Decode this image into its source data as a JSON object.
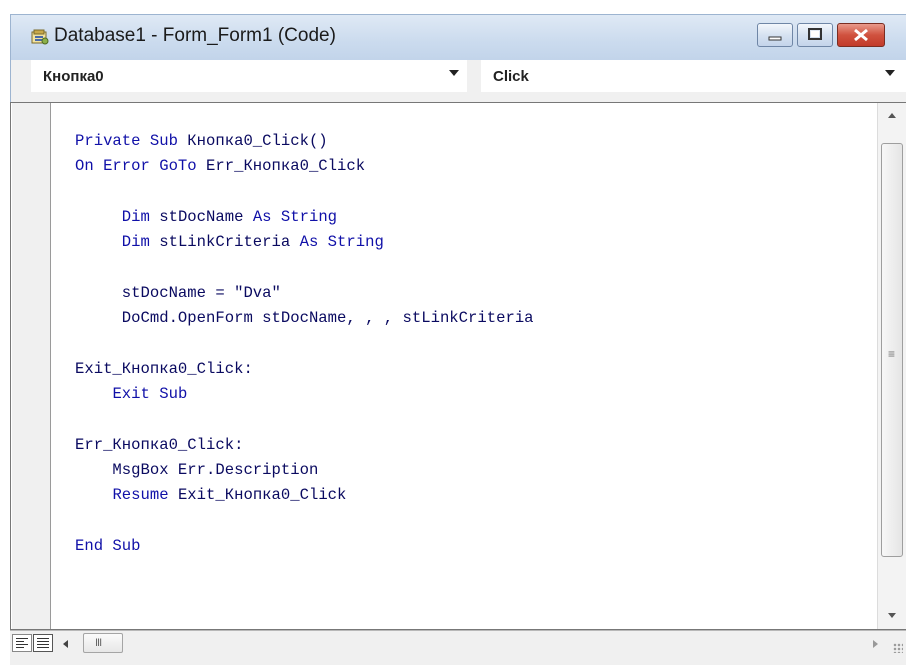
{
  "window": {
    "title": "Database1 - Form_Form1 (Code)"
  },
  "toolbar": {
    "object_combo": "Кнопка0",
    "procedure_combo": "Click"
  },
  "code_lines": [
    [
      {
        "t": "Private Sub ",
        "k": 1
      },
      {
        "t": "Кнопка0_Click()",
        "k": 0
      }
    ],
    [
      {
        "t": "On Error GoTo ",
        "k": 1
      },
      {
        "t": "Err_Кнопка0_Click",
        "k": 0
      }
    ],
    [],
    [
      {
        "t": "     ",
        "k": 0
      },
      {
        "t": "Dim ",
        "k": 1
      },
      {
        "t": "stDocName ",
        "k": 0
      },
      {
        "t": "As String",
        "k": 1
      }
    ],
    [
      {
        "t": "     ",
        "k": 0
      },
      {
        "t": "Dim ",
        "k": 1
      },
      {
        "t": "stLinkCriteria ",
        "k": 0
      },
      {
        "t": "As String",
        "k": 1
      }
    ],
    [],
    [
      {
        "t": "     stDocName = \"Dva\"",
        "k": 0
      }
    ],
    [
      {
        "t": "     DoCmd.OpenForm stDocName, , , stLinkCriteria",
        "k": 0
      }
    ],
    [],
    [
      {
        "t": "Exit_Кнопка0_Click:",
        "k": 0
      }
    ],
    [
      {
        "t": "    ",
        "k": 0
      },
      {
        "t": "Exit Sub",
        "k": 1
      }
    ],
    [],
    [
      {
        "t": "Err_Кнопка0_Click:",
        "k": 0
      }
    ],
    [
      {
        "t": "    MsgBox Err.Description",
        "k": 0
      }
    ],
    [
      {
        "t": "    ",
        "k": 0
      },
      {
        "t": "Resume ",
        "k": 1
      },
      {
        "t": "Exit_Кнопка0_Click",
        "k": 0
      }
    ],
    [],
    [
      {
        "t": "End Sub",
        "k": 1
      }
    ]
  ],
  "icons": {
    "window_icon": "database-form-icon",
    "minimize": "minimize-icon",
    "maximize": "maximize-icon",
    "close": "close-icon",
    "combo_arrow": "chevron-down-icon",
    "procedure_view": "procedure-view-icon",
    "full_module_view": "full-module-view-icon"
  },
  "colors": {
    "keyword": "#1010a8",
    "identifier": "#0a0a60",
    "close_button": "#c8402c",
    "titlebar": "#cbdbee"
  }
}
